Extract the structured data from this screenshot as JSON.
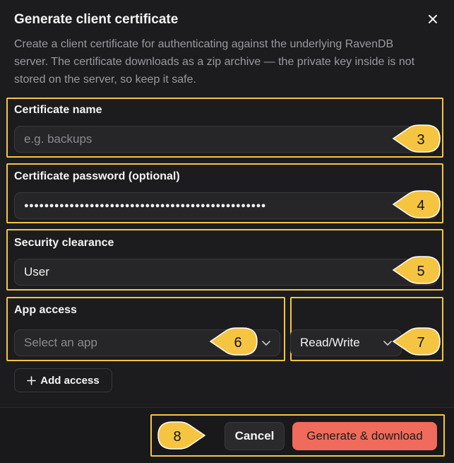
{
  "dialog": {
    "title": "Generate client certificate",
    "description": "Create a client certificate for authenticating against the underlying RavenDB server. The certificate downloads as a zip archive — the private key inside is not stored on the server, so keep it safe."
  },
  "fields": {
    "name": {
      "label": "Certificate name",
      "placeholder": "e.g. backups",
      "value": ""
    },
    "password": {
      "label": "Certificate password (optional)",
      "value": "●●●●●●●●●●●●●●●●●●●●●●●●●●●●●●●●●●●●●●●●●●●●●●●●"
    },
    "clearance": {
      "label": "Security clearance",
      "value": "User"
    },
    "app_access": {
      "label": "App access",
      "placeholder": "Select an app",
      "permission": "Read/Write"
    }
  },
  "actions": {
    "add_access": "Add access",
    "cancel": "Cancel",
    "generate": "Generate & download"
  },
  "annotations": {
    "badge_3": "3",
    "badge_4": "4",
    "badge_5": "5",
    "badge_6": "6",
    "badge_7": "7",
    "badge_8": "8"
  },
  "colors": {
    "background": "#1c1c1e",
    "annotation": "#f5c542",
    "primary": "#f06b5b"
  }
}
